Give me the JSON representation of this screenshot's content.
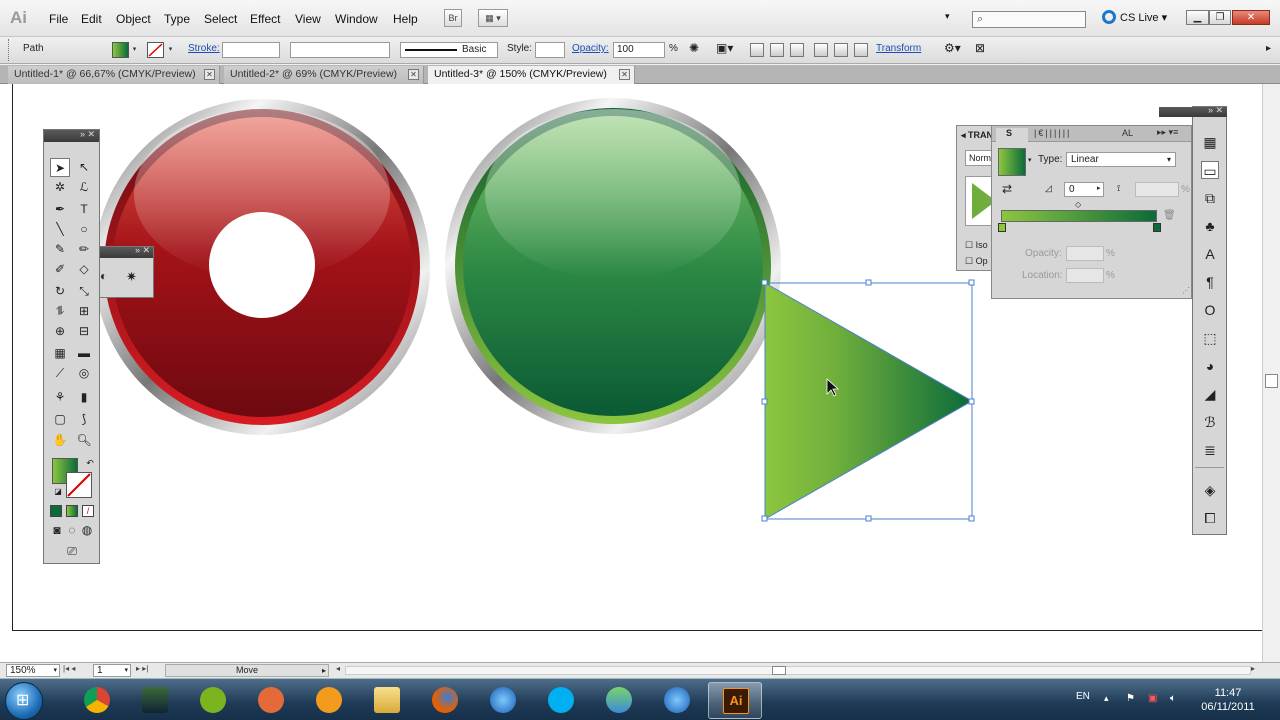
{
  "app": {
    "logo": "Ai"
  },
  "menu": [
    "File",
    "Edit",
    "Object",
    "Type",
    "Select",
    "Effect",
    "View",
    "Window",
    "Help"
  ],
  "menu_buttons": {
    "bridge": "Br"
  },
  "cslive": "CS Live",
  "control_bar": {
    "selection_type": "Path",
    "stroke_label": "Stroke:",
    "brush_label": "Basic",
    "style_label": "Style:",
    "opacity_label": "Opacity:",
    "opacity_value": "100",
    "opacity_unit": "%",
    "transform_link": "Transform"
  },
  "tabs": [
    {
      "label": "Untitled-1* @ 66,67% (CMYK/Preview)",
      "active": false
    },
    {
      "label": "Untitled-2* @ 69% (CMYK/Preview)",
      "active": false
    },
    {
      "label": "Untitled-3* @ 150% (CMYK/Preview)",
      "active": true
    }
  ],
  "status_bar": {
    "zoom": "150%",
    "artboard": "1",
    "tool": "Move"
  },
  "trans_panel": {
    "tab": "TRAN",
    "blend_mode": "Norm",
    "iso": "Iso",
    "op": "Op"
  },
  "gradient_panel": {
    "type_label": "Type:",
    "type_value": "Linear",
    "angle_value": "0",
    "aspect_unit": "%",
    "opacity_label": "Opacity:",
    "location_label": "Location:",
    "percent": "%",
    "tab_s": "S",
    "tab_al": "AL",
    "start_color": "#8cc63f",
    "end_color": "#0b6b3a"
  },
  "colors": {
    "red_button": "#b3141c",
    "green_button": "#2f8f46",
    "fill_swatch": "#4f9a45"
  },
  "taskbar": {
    "apps": [
      "chrome-icon",
      "hardware-icon",
      "spotify-icon",
      "ccleaner-icon",
      "media-player-icon",
      "explorer-icon",
      "firefox-icon",
      "itunes-icon",
      "skype-icon",
      "messenger-icon",
      "itunes2-icon",
      "illustrator-icon"
    ],
    "ai_label": "Ai",
    "language": "EN",
    "time": "11:47",
    "date": "06/11/2011"
  }
}
